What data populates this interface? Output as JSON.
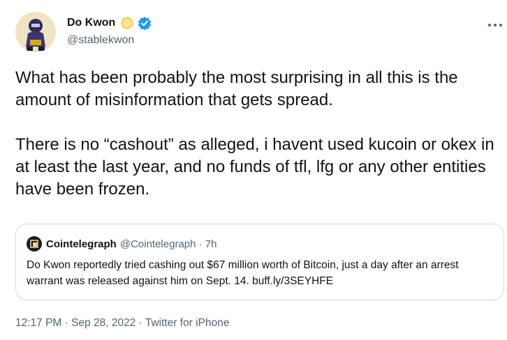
{
  "author": {
    "name": "Do Kwon",
    "handle": "@stablekwon"
  },
  "tweet": {
    "text": "What has been probably the most surprising in all this is the amount of misinformation that gets spread.\n\nThere is no “cashout” as alleged, i havent used kucoin or okex in at least the last year, and no funds of tfl, lfg or any other entities have been frozen."
  },
  "quote": {
    "name": "Cointelegraph",
    "handle_time": "@Cointelegraph · 7h",
    "text": "Do Kwon reportedly tried cashing out $67 million worth of Bitcoin, just a day after an arrest warrant was released against him on Sept. 14. buff.ly/3SEYHFE"
  },
  "meta": {
    "text": "12:17 PM · Sep 28, 2022 · Twitter for iPhone"
  },
  "icons": {
    "sun": "sun-emoji-icon",
    "verified": "verified-badge-icon",
    "more": "more-options-icon"
  },
  "colors": {
    "verified": "#1d9bf0",
    "secondary_text": "#536471",
    "border": "#cfd9de"
  }
}
